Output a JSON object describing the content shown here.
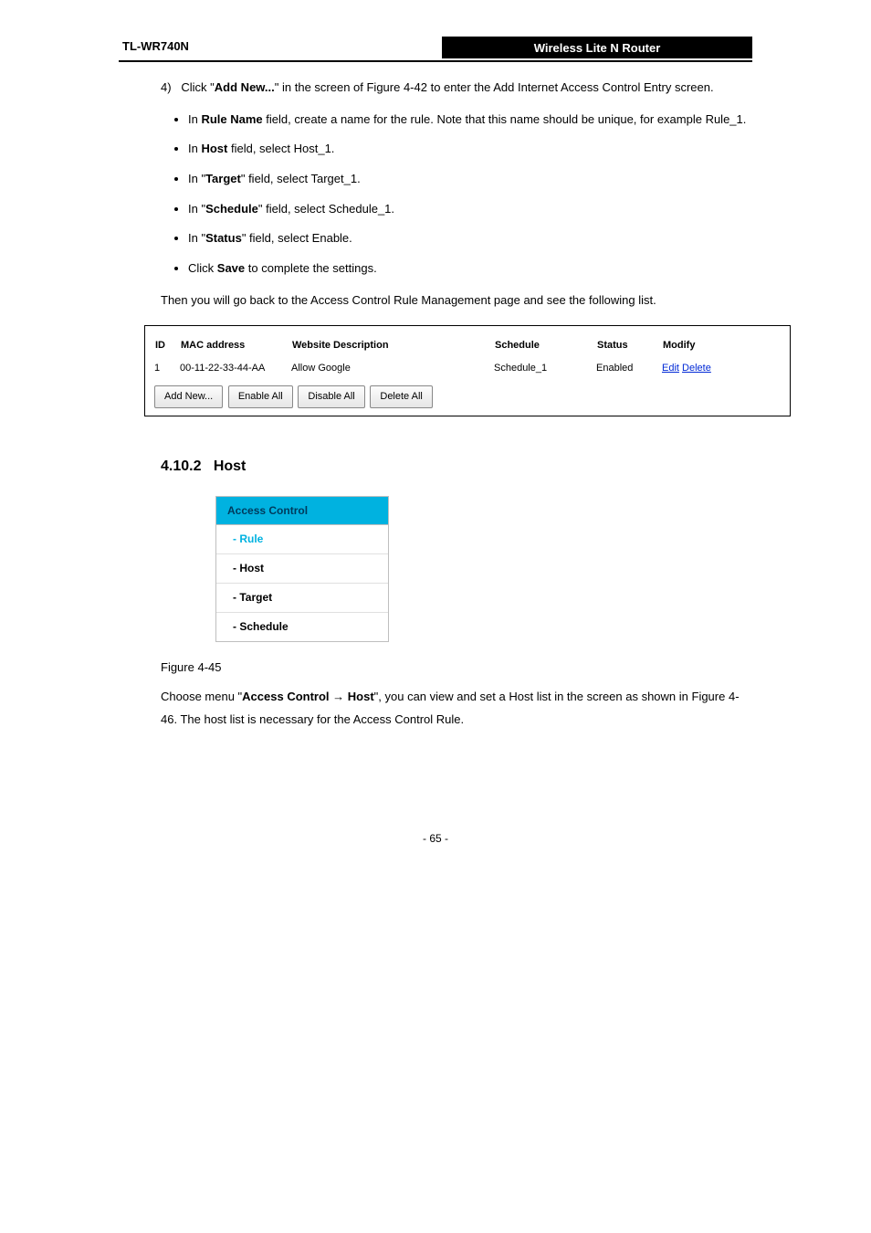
{
  "header": {
    "doc_label": "TL-WR740N",
    "title": "Wireless Lite N Router"
  },
  "step4": {
    "intro": "4)   Click \"Add New...\" in the screen of Figure 4-42 to enter the Add Internet Access Control Entry screen.",
    "bullets": [
      "In Rule Name field, create a name for the rule. Note that this name should be unique, for example Rule_1.",
      "In Host field, select Host_1.",
      "In Target field, select Target_1.",
      "In Schedule field, select Schedule_1.",
      "In Status field, select Enable."
    ],
    "rule_name_hint": "\"Rule Name\"",
    "host_literal": "\"Host\"",
    "target_literal": "\"Target\"",
    "schedule_literal": "\"Schedule\"",
    "click_save": "Click Save to complete the settings.",
    "then_back": "Then you will go back to the Access Control Rule Management page and see the following list."
  },
  "table": {
    "headers": {
      "id": "ID",
      "mac": "MAC address",
      "web": "Website Description",
      "sch": "Schedule",
      "stat": "Status",
      "mod": "Modify"
    },
    "row": {
      "id": "1",
      "mac": "00-11-22-33-44-AA",
      "web": "Allow Google",
      "sch": "Schedule_1",
      "stat": "Enabled",
      "edit": "Edit",
      "del": "Delete"
    },
    "buttons": {
      "add": "Add New...",
      "enable": "Enable All",
      "disable": "Disable All",
      "delete": "Delete All"
    }
  },
  "section": {
    "num": "4.10.2",
    "title": "Host"
  },
  "nav": {
    "header": "Access Control",
    "items": [
      "- Rule",
      "- Host",
      "- Target",
      "- Schedule"
    ]
  },
  "fig": {
    "caption": "Figure 4-45"
  },
  "para1": "Choose menu \"Access Control → Host\", you can view and set a Host list in the screen as shown in Figure 4-46. The host list is necessary for the Access Control Rule.",
  "arrow": "→",
  "page_num": "- 65 -"
}
